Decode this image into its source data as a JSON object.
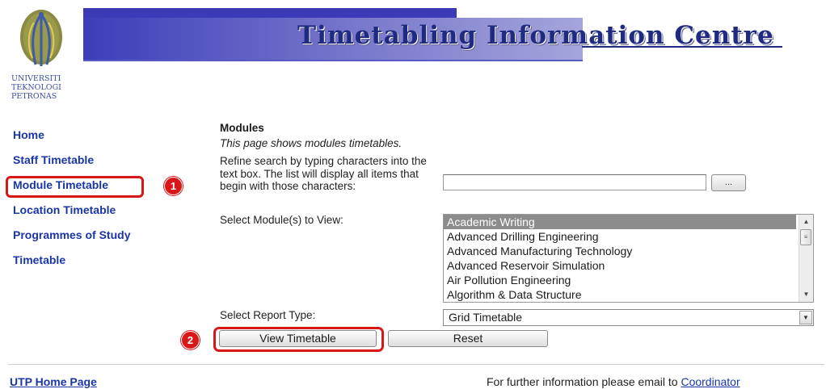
{
  "header": {
    "title": "Timetabling Information Centre",
    "logo_text": [
      "UNIVERSITI",
      "TEKNOLOGI",
      "PETRONAS"
    ]
  },
  "nav": {
    "items": [
      {
        "label": "Home"
      },
      {
        "label": "Staff Timetable"
      },
      {
        "label": "Module Timetable"
      },
      {
        "label": "Location Timetable"
      },
      {
        "label": "Programmes of Study"
      },
      {
        "label": "Timetable"
      }
    ]
  },
  "markers": {
    "one": "1",
    "two": "2"
  },
  "main": {
    "heading": "Modules",
    "description": "This page shows modules timetables.",
    "refine_text": "Refine search by typing characters into the text box. The list will display all items that begin with those characters:",
    "search": {
      "value": "",
      "button_label": "..."
    },
    "select_label": "Select Module(s) to View:",
    "modules": [
      "Academic Writing",
      "Advanced Drilling Engineering",
      "Advanced Manufacturing Technology",
      "Advanced Reservoir Simulation",
      "Air Pollution Engineering",
      "Algorithm & Data Structure"
    ],
    "selected_module": "Academic Writing",
    "report_label": "Select Report Type:",
    "report_type": "Grid Timetable",
    "view_button": "View Timetable",
    "reset_button": "Reset"
  },
  "footer": {
    "home_link": "UTP Home Page",
    "note": "For further information please email to",
    "coordinator": "Coordinator"
  },
  "colors": {
    "accent_red": "#d81818",
    "link_blue": "#1a35a8",
    "header_blue": "#3b3bb8"
  }
}
